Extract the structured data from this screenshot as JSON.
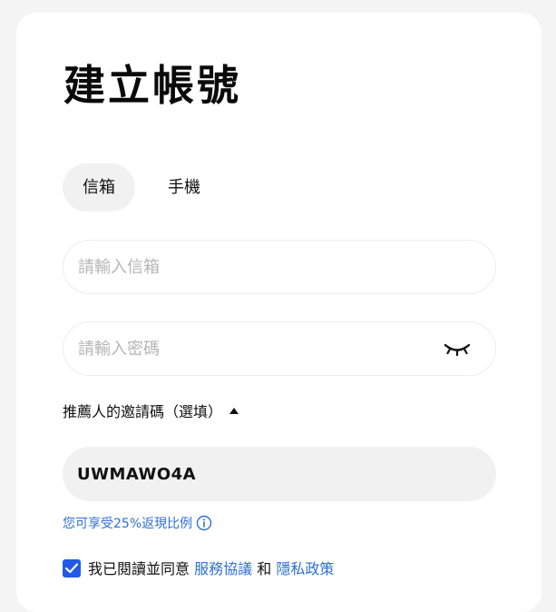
{
  "page": {
    "title": "建立帳號"
  },
  "tabs": [
    {
      "label": "信箱",
      "active": true
    },
    {
      "label": "手機",
      "active": false
    }
  ],
  "email": {
    "value": "",
    "placeholder": "請輸入信箱"
  },
  "password": {
    "value": "",
    "placeholder": "請輸入密碼",
    "visibility_icon": "eye-closed-icon"
  },
  "referral": {
    "toggle_label": "推薦人的邀請碼（選填）",
    "expanded": true,
    "code": "UWMAWO4A",
    "rebate_text": "您可享受25%返現比例"
  },
  "agreement": {
    "checked": true,
    "prefix": "我已閱讀並同意",
    "terms_link": "服務協議",
    "conjunction": "和",
    "privacy_link": "隱私政策"
  },
  "colors": {
    "accent": "#1f5be8",
    "link": "#2e6fd6"
  }
}
